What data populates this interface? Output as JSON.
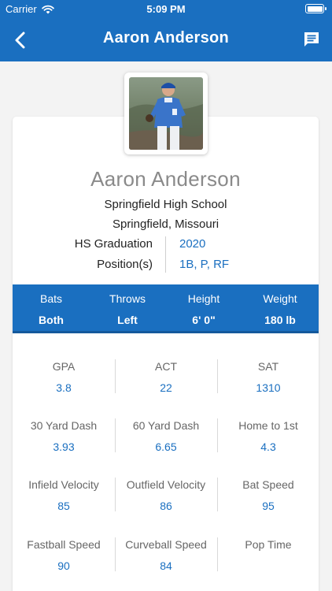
{
  "status": {
    "carrier": "Carrier",
    "time": "5:09 PM"
  },
  "nav": {
    "title": "Aaron Anderson"
  },
  "profile": {
    "name": "Aaron Anderson",
    "school": "Springfield High School",
    "city": "Springfield, Missouri",
    "graduation_label": "HS Graduation",
    "graduation_value": "2020",
    "positions_label": "Position(s)",
    "positions_value": "1B, P, RF"
  },
  "band": [
    {
      "label": "Bats",
      "value": "Both"
    },
    {
      "label": "Throws",
      "value": "Left"
    },
    {
      "label": "Height",
      "value": "6' 0\""
    },
    {
      "label": "Weight",
      "value": "180 lb"
    }
  ],
  "stats": [
    {
      "label": "GPA",
      "value": "3.8"
    },
    {
      "label": "ACT",
      "value": "22"
    },
    {
      "label": "SAT",
      "value": "1310"
    },
    {
      "label": "30 Yard Dash",
      "value": "3.93"
    },
    {
      "label": "60 Yard Dash",
      "value": "6.65"
    },
    {
      "label": "Home to 1st",
      "value": "4.3"
    },
    {
      "label": "Infield Velocity",
      "value": "85"
    },
    {
      "label": "Outfield Velocity",
      "value": "86"
    },
    {
      "label": "Bat Speed",
      "value": "95"
    },
    {
      "label": "Fastball Speed",
      "value": "90"
    },
    {
      "label": "Curveball Speed",
      "value": "84"
    },
    {
      "label": "Pop Time",
      "value": ""
    }
  ],
  "colors": {
    "brand": "#1a6fc0",
    "value_text": "#1a6fc0"
  },
  "icons": {
    "back": "chevron-left-icon",
    "message": "message-icon",
    "wifi": "wifi-icon",
    "battery": "battery-icon"
  }
}
